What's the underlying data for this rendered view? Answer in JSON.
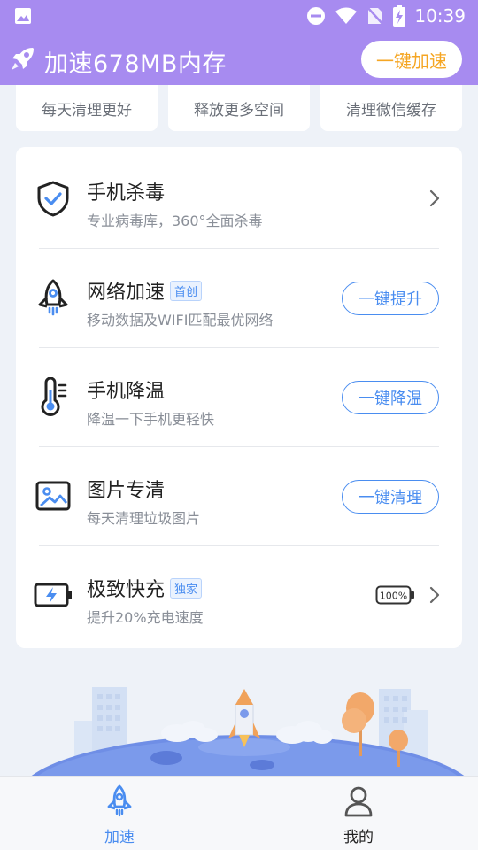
{
  "status_bar": {
    "time": "10:39",
    "icons": [
      "image-icon",
      "dnd-icon",
      "wifi-icon",
      "no-sim-icon",
      "battery-charging-icon"
    ]
  },
  "header": {
    "title": "加速678MB内存",
    "boost_button": "一键加速"
  },
  "quick_tabs": [
    {
      "label": "每天清理更好"
    },
    {
      "label": "释放更多空间"
    },
    {
      "label": "清理微信缓存"
    }
  ],
  "features": [
    {
      "icon": "shield-check-icon",
      "title": "手机杀毒",
      "tag": "",
      "subtitle": "专业病毒库，360°全面杀毒",
      "action": "chevron"
    },
    {
      "icon": "rocket-icon",
      "title": "网络加速",
      "tag": "首创",
      "subtitle": "移动数据及WIFI匹配最优网络",
      "action": "一键提升"
    },
    {
      "icon": "thermometer-icon",
      "title": "手机降温",
      "tag": "",
      "subtitle": "降温一下手机更轻快",
      "action": "一键降温"
    },
    {
      "icon": "picture-icon",
      "title": "图片专清",
      "tag": "",
      "subtitle": "每天清理垃圾图片",
      "action": "一键清理"
    },
    {
      "icon": "battery-flash-icon",
      "title": "极致快充",
      "tag": "独家",
      "subtitle": "提升20%充电速度",
      "action": "chevron",
      "battery_label": "100%"
    }
  ],
  "bottom_nav": [
    {
      "label": "加速",
      "icon": "rocket-nav-icon",
      "active": true
    },
    {
      "label": "我的",
      "icon": "person-icon",
      "active": false
    }
  ],
  "colors": {
    "header_bg": "#a78bf0",
    "accent_blue": "#4a8df0",
    "boost_orange": "#f5a623",
    "page_bg": "#eef2f8"
  }
}
